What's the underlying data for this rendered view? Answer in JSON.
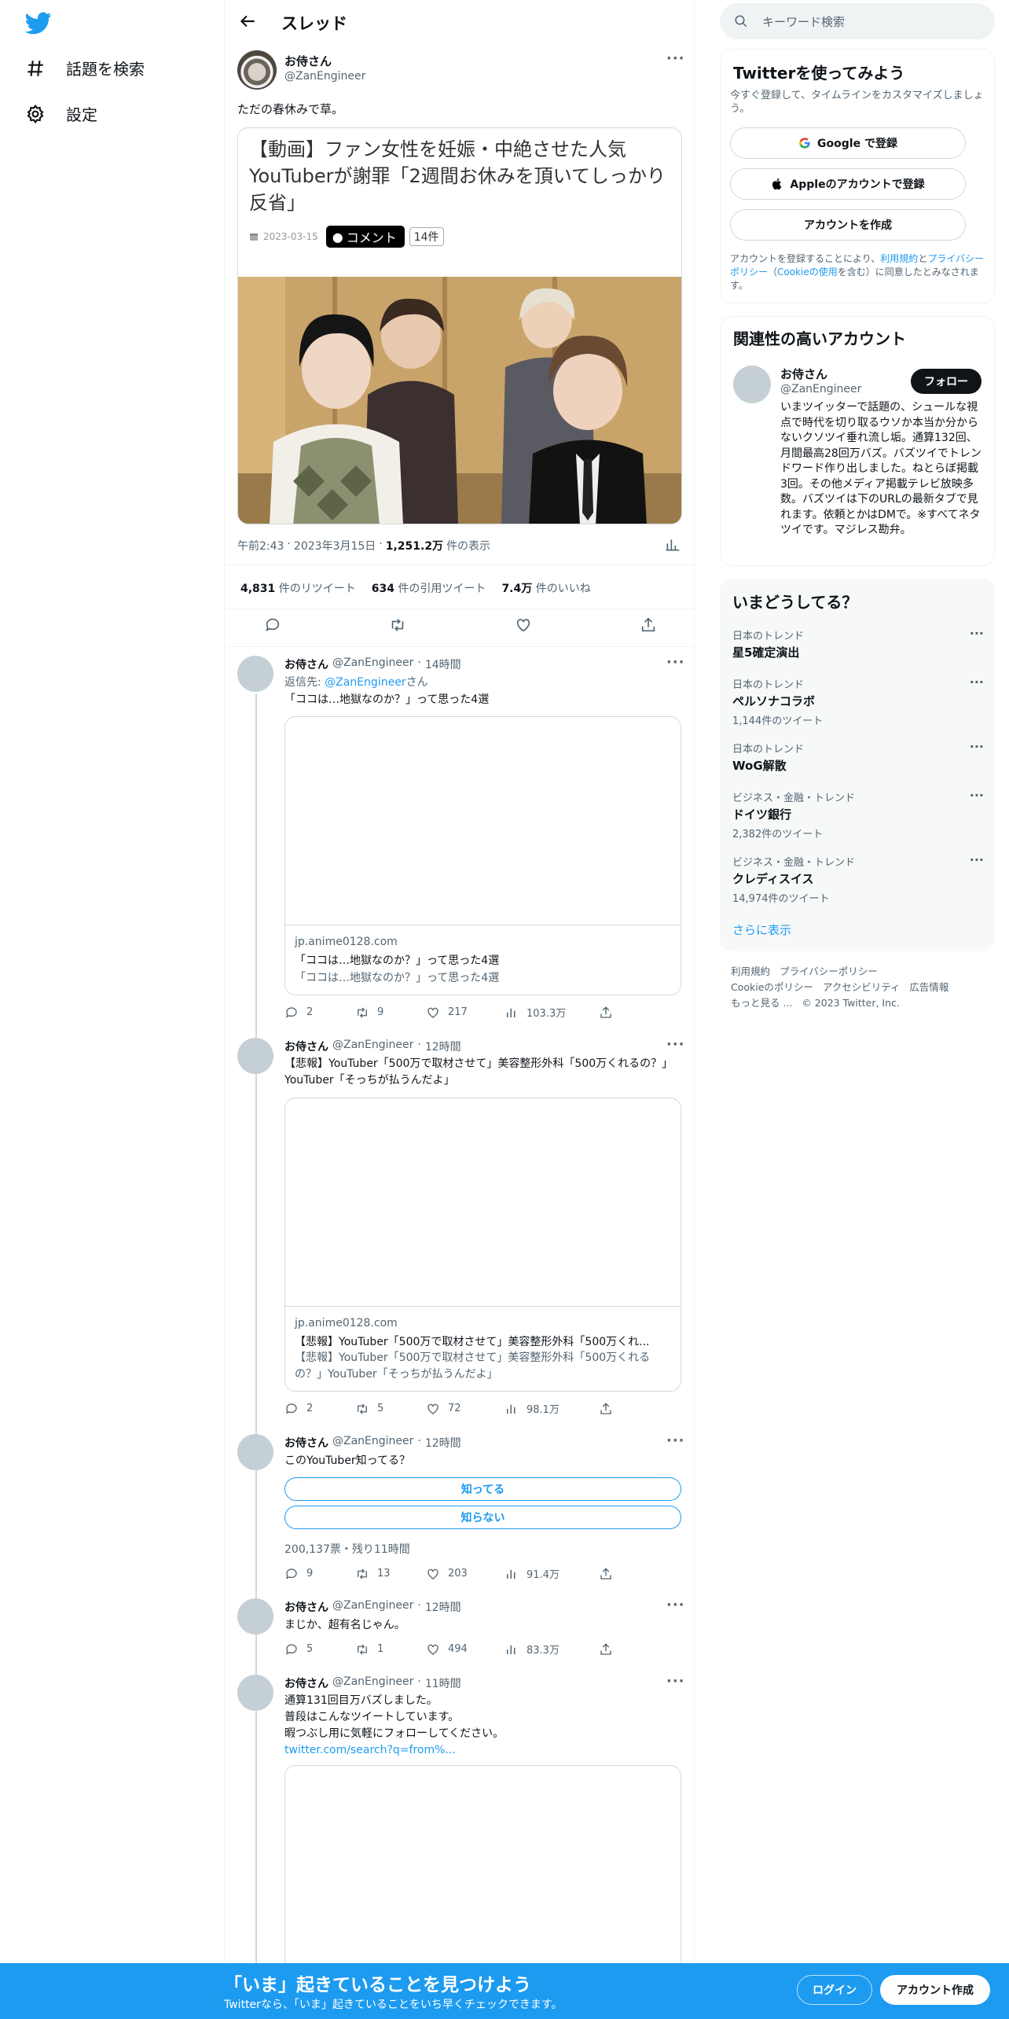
{
  "nav": {
    "explore_label": "話題を検索",
    "settings_label": "設定"
  },
  "header": {
    "title": "スレッド"
  },
  "main_tweet": {
    "name": "お侍さん",
    "handle": "@ZanEngineer",
    "text": "ただの春休みで草。",
    "card": {
      "headline": "【動画】ファン女性を妊娠・中絶させた人気YouTuberが謝罪「2週間お休みを頂いてしっかり反省」",
      "date": "2023-03-15",
      "comment_label": "コメント",
      "comment_count": "14件"
    },
    "time": "午前2:43",
    "date": "2023年3月15日",
    "views_count": "1,251.2万",
    "views_label": "件の表示",
    "retweets_count": "4,831",
    "retweets_label": "件のリツイート",
    "quotes_count": "634",
    "quotes_label": "件の引用ツイート",
    "likes_count": "7.4万",
    "likes_label": "件のいいね"
  },
  "replies": [
    {
      "name": "お侍さん",
      "handle": "@ZanEngineer",
      "time": "14時間",
      "reply_prefix": "返信先: ",
      "reply_to": "@ZanEngineer",
      "reply_suffix": "さん",
      "text": "「ココは…地獄なのか？」って思った4選",
      "card_domain": "jp.anime0128.com",
      "card_title": "「ココは…地獄なのか？」って思った4選",
      "card_desc": "「ココは…地獄なのか？」って思った4選",
      "replies": "2",
      "retweets": "9",
      "likes": "217",
      "views": "103.3万"
    },
    {
      "name": "お侍さん",
      "handle": "@ZanEngineer",
      "time": "12時間",
      "text": "【悲報】YouTuber「500万で取材させて」美容整形外科「500万くれるの？」YouTuber「そっちが払うんだよ」",
      "card_domain": "jp.anime0128.com",
      "card_title": "【悲報】YouTuber「500万で取材させて」美容整形外科「500万くれ...",
      "card_desc": "【悲報】YouTuber「500万で取材させて」美容整形外科「500万くれるの？」YouTuber「そっちが払うんだよ」",
      "replies": "2",
      "retweets": "5",
      "likes": "72",
      "views": "98.1万"
    },
    {
      "name": "お侍さん",
      "handle": "@ZanEngineer",
      "time": "12時間",
      "text": "このYouTuber知ってる？",
      "poll_options": [
        "知ってる",
        "知らない"
      ],
      "poll_meta": "200,137票・残り11時間",
      "replies": "9",
      "retweets": "13",
      "likes": "203",
      "views": "91.4万"
    },
    {
      "name": "お侍さん",
      "handle": "@ZanEngineer",
      "time": "12時間",
      "text": "まじか、超有名じゃん。",
      "replies": "5",
      "retweets": "1",
      "likes": "494",
      "views": "83.3万"
    },
    {
      "name": "お侍さん",
      "handle": "@ZanEngineer",
      "time": "11時間",
      "line1": "通算131回目万バズしました。",
      "line2": "普段はこんなツイートしています。",
      "line3": "暇つぶし用に気軽にフォローしてください。",
      "link": "twitter.com/search?q=from%..."
    }
  ],
  "search": {
    "placeholder": "キーワード検索"
  },
  "signup": {
    "title": "Twitterを使ってみよう",
    "subtitle": "今すぐ登録して、タイムラインをカスタマイズしましょう。",
    "google_label": "Google で登録",
    "apple_label": "Appleのアカウントで登録",
    "create_label": "アカウントを作成",
    "terms_prefix": "アカウントを登録することにより、",
    "terms_link": "利用規約",
    "terms_and": "と",
    "privacy_link": "プライバシーポリシー",
    "cookie_open": "（",
    "cookie_link": "Cookieの使用",
    "terms_suffix": "を含む）に同意したとみなされます。"
  },
  "related": {
    "title": "関連性の高いアカウント",
    "name": "お侍さん",
    "handle": "@ZanEngineer",
    "follow_label": "フォロー",
    "bio": "いまツイッターで話題の、シュールな視点で時代を切り取るウソか本当か分からないクソツイ垂れ流し垢。通算132回、月間最高28回万バズ。バズツイでトレンドワード作り出しました。ねとらぼ掲載3回。その他メディア掲載テレビ放映多数。バズツイは下のURLの最新タブで見れます。依頼とかはDMで。※すべてネタツイです。マジレス勘弁。"
  },
  "trends": {
    "title": "いまどうしてる？",
    "items": [
      {
        "category": "日本のトレンド",
        "name": "星5確定演出",
        "count": ""
      },
      {
        "category": "日本のトレンド",
        "name": "ペルソナコラボ",
        "count": "1,144件のツイート"
      },
      {
        "category": "日本のトレンド",
        "name": "WoG解散",
        "count": ""
      },
      {
        "category": "ビジネス・金融・トレンド",
        "name": "ドイツ銀行",
        "count": "2,382件のツイート"
      },
      {
        "category": "ビジネス・金融・トレンド",
        "name": "クレディスイス",
        "count": "14,974件のツイート"
      }
    ],
    "show_more": "さらに表示"
  },
  "footer": {
    "terms": "利用規約",
    "privacy": "プライバシーポリシー",
    "cookie": "Cookieのポリシー",
    "accessibility": "アクセシビリティ",
    "ads": "広告情報",
    "more": "もっと見る ...",
    "copyright": "© 2023 Twitter, Inc."
  },
  "bottom_bar": {
    "headline": "「いま」起きていることを見つけよう",
    "sub": "Twitterなら、「いま」起きていることをいち早くチェックできます。",
    "login_label": "ログイン",
    "signup_label": "アカウント作成"
  },
  "colors": {
    "accent": "#1d9bf0",
    "text": "#0f1419",
    "muted": "#536471",
    "border": "#cfd9de"
  }
}
